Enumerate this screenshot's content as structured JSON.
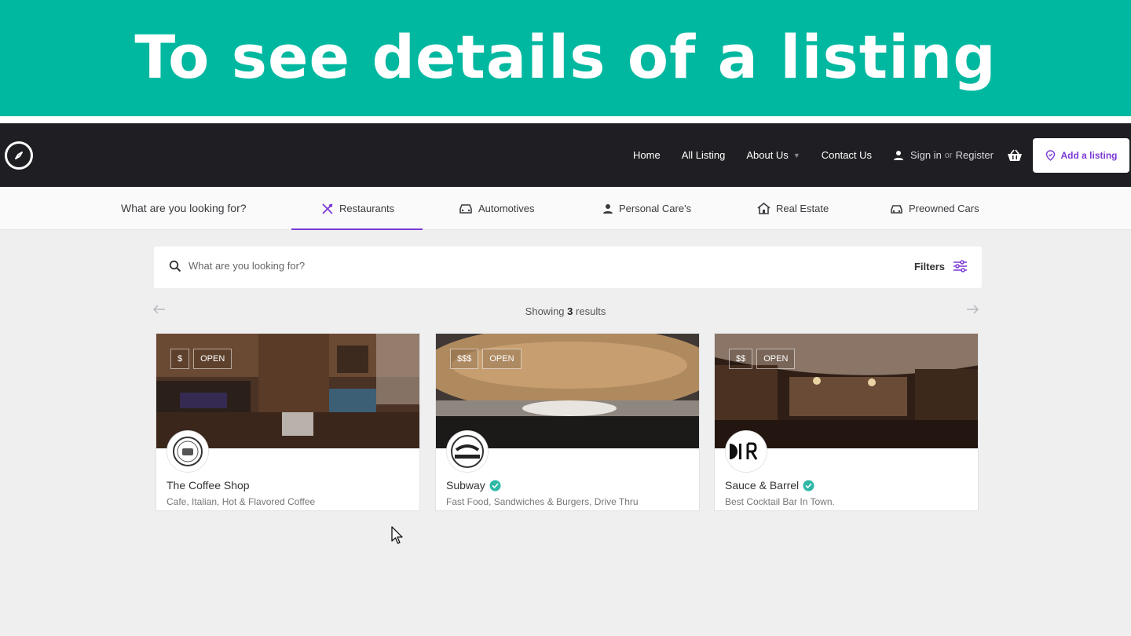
{
  "banner": {
    "title": "To see details of a listing"
  },
  "nav": {
    "home": "Home",
    "all_listing": "All Listing",
    "about": "About Us",
    "contact": "Contact Us",
    "sign_in": "Sign in",
    "or": "or",
    "register": "Register",
    "add_listing": "Add a listing"
  },
  "categories": {
    "question": "What are you looking for?",
    "tabs": [
      "Restaurants",
      "Automotives",
      "Personal Care's",
      "Real Estate",
      "Preowned Cars"
    ],
    "active": "Restaurants"
  },
  "search": {
    "placeholder": "What are you looking for?",
    "filters_label": "Filters"
  },
  "results": {
    "prefix": "Showing",
    "count": "3",
    "suffix": "results"
  },
  "listings": [
    {
      "name": "The Coffee Shop",
      "description": "Cafe, Italian, Hot & Flavored Coffee",
      "price": "$",
      "status": "OPEN",
      "verified": false
    },
    {
      "name": "Subway",
      "description": "Fast Food, Sandwiches & Burgers, Drive Thru",
      "price": "$$$",
      "status": "OPEN",
      "verified": true
    },
    {
      "name": "Sauce & Barrel",
      "description": "Best Cocktail Bar In Town.",
      "price": "$$",
      "status": "OPEN",
      "verified": true
    }
  ],
  "colors": {
    "banner": "#00b8a0",
    "navbar": "#1f1e23",
    "accent": "#7b3ad6",
    "verified": "#2fb8a6"
  }
}
